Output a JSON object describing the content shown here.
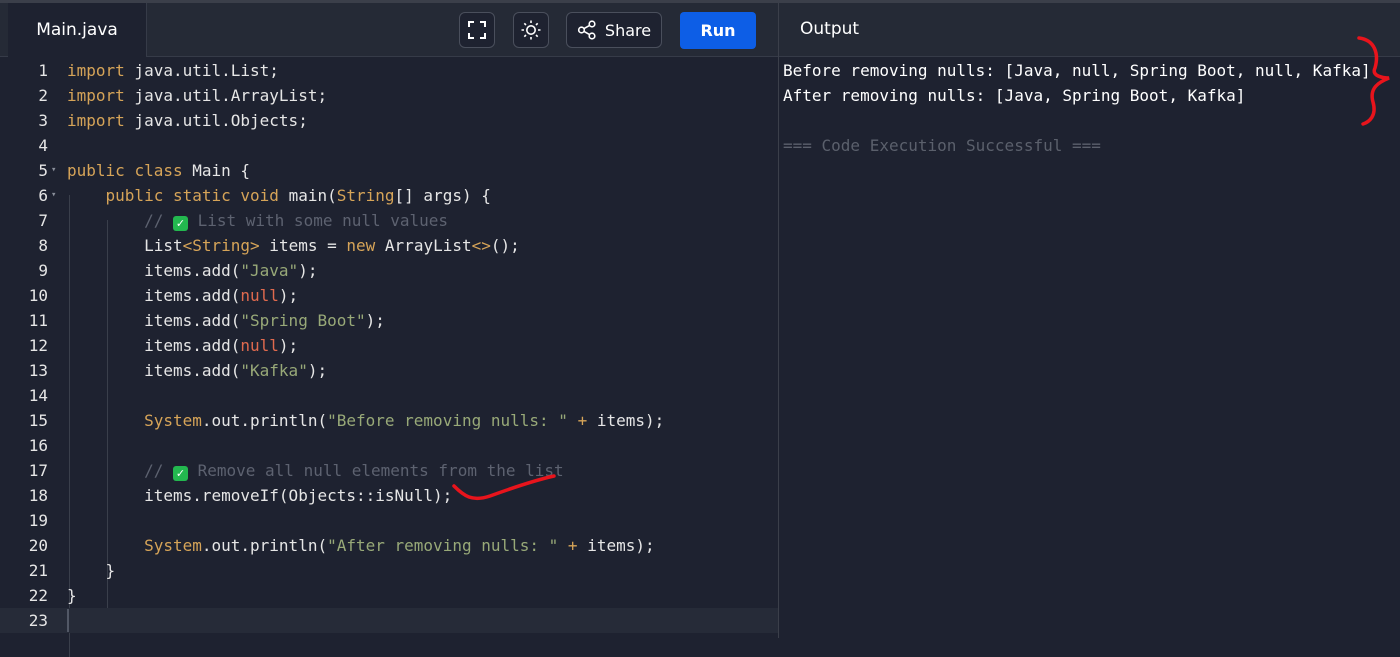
{
  "editor": {
    "file_tab": "Main.java",
    "toolbar": {
      "fullscreen_icon": "fullscreen-icon",
      "theme_icon": "sun-icon",
      "share_icon": "share-icon",
      "share_label": "Share",
      "run_label": "Run"
    },
    "line_numbers": [
      "1",
      "2",
      "3",
      "4",
      "5",
      "6",
      "7",
      "8",
      "9",
      "10",
      "11",
      "12",
      "13",
      "14",
      "15",
      "16",
      "17",
      "18",
      "19",
      "20",
      "21",
      "22",
      "23"
    ],
    "code_lines": [
      "import java.util.List;",
      "import java.util.ArrayList;",
      "import java.util.Objects;",
      "",
      "public class Main {",
      "    public static void main(String[] args) {",
      "        // ✅ List with some null values",
      "        List<String> items = new ArrayList<>();",
      "        items.add(\"Java\");",
      "        items.add(null);",
      "        items.add(\"Spring Boot\");",
      "        items.add(null);",
      "        items.add(\"Kafka\");",
      "",
      "        System.out.println(\"Before removing nulls: \" + items);",
      "",
      "        // ✅ Remove all null elements from the list",
      "        items.removeIf(Objects::isNull);",
      "",
      "        System.out.println(\"After removing nulls: \" + items);",
      "    }",
      "}",
      ""
    ]
  },
  "output": {
    "title": "Output",
    "lines": [
      "Before removing nulls: [Java, null, Spring Boot, null, Kafka]",
      "After removing nulls: [Java, Spring Boot, Kafka]",
      "",
      "=== Code Execution Successful ==="
    ]
  },
  "colors": {
    "run_button": "#0d5ee6",
    "annotation": "#e8141c",
    "keyword": "#d6a458",
    "string": "#98a978",
    "null_literal": "#e06a4e",
    "comment": "#5d6270"
  }
}
